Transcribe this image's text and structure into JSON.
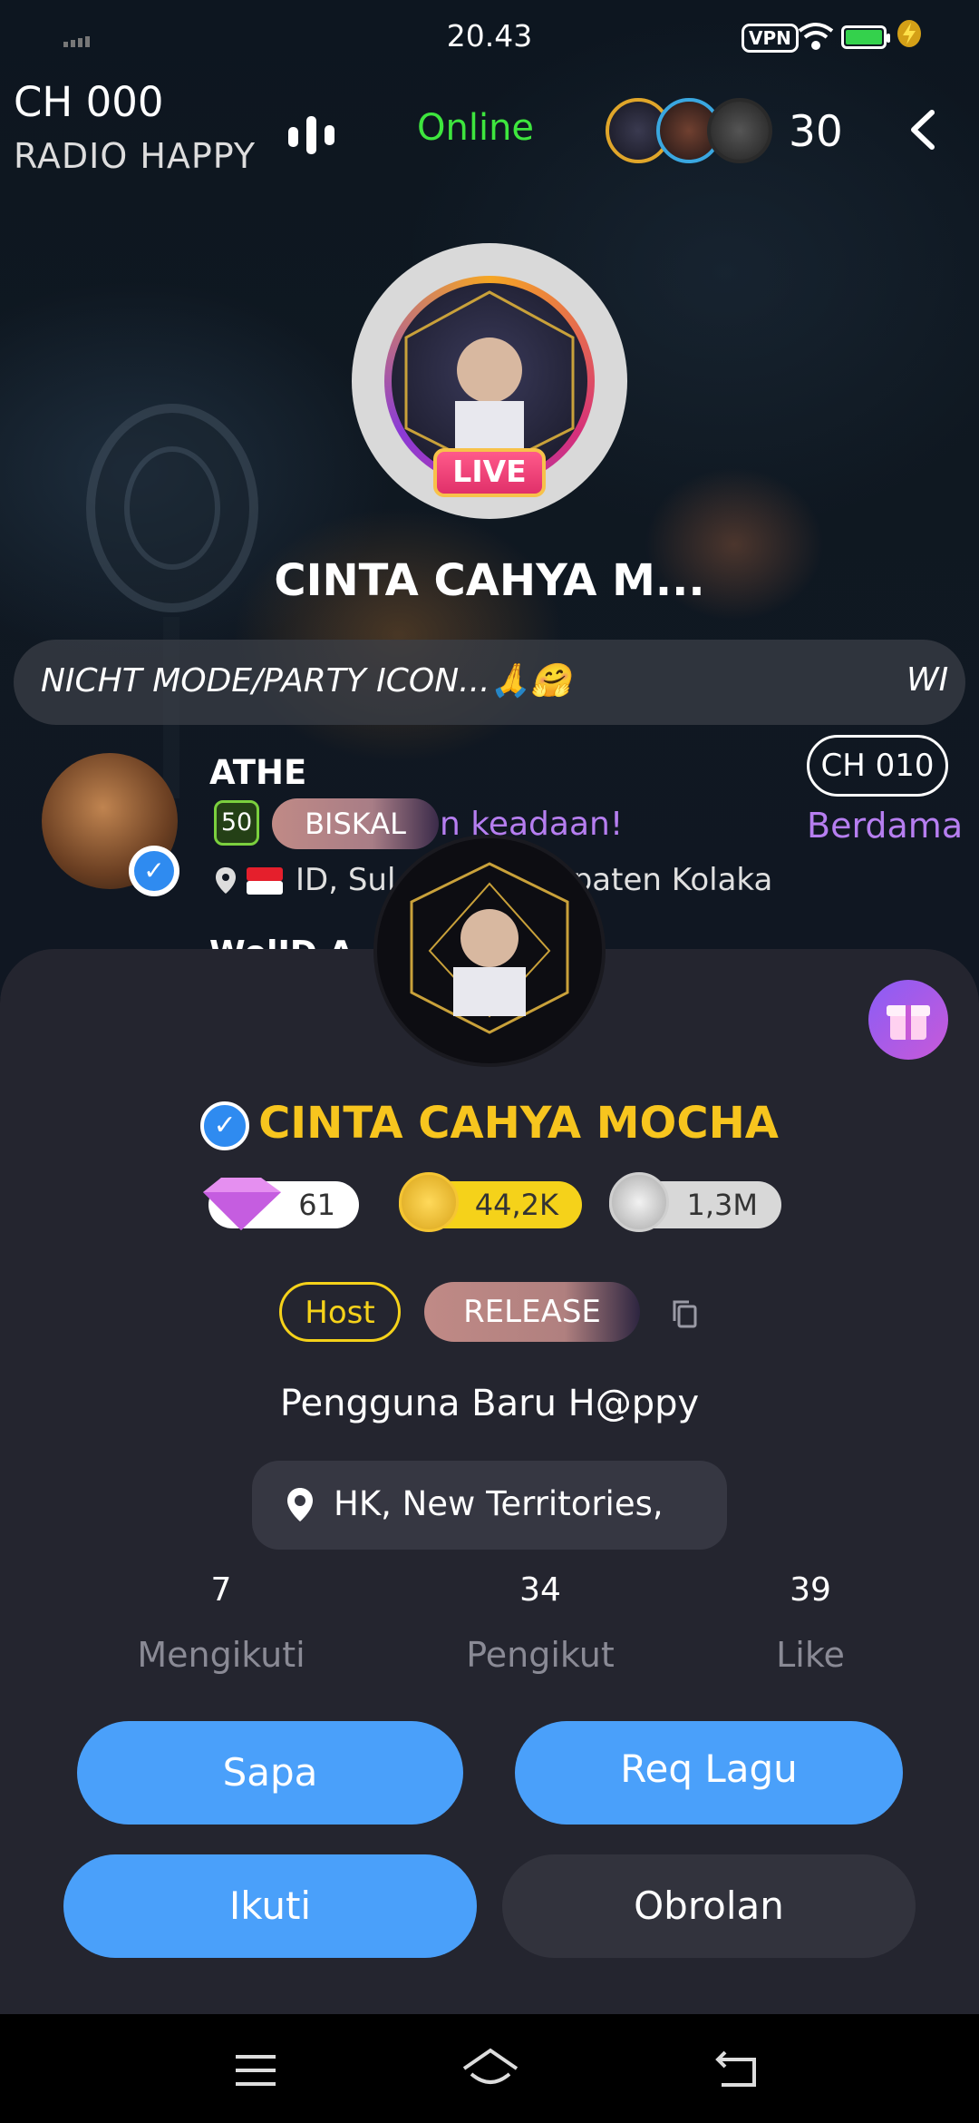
{
  "status_bar": {
    "time": "20.43",
    "vpn": "VPN"
  },
  "header": {
    "channel": "CH 000",
    "radio_name": "RADIO HAPPY",
    "status": "Online",
    "listener_count": "30"
  },
  "host": {
    "name": "CINTA CAHYA M...",
    "live_badge": "LIVE"
  },
  "marquee": {
    "text": "NICHT MODE/PARTY ICON...🙏🤗",
    "text_repeat": "WI"
  },
  "listener": {
    "name": "ATHE",
    "level": "50",
    "badge": "BISKAL",
    "channel_badge": "CH 010",
    "message": "n keadaan!",
    "message2": "Berdama",
    "location": "ID, Sul      gara, Kabupaten Kolaka",
    "next_name": "WolID A"
  },
  "profile": {
    "name": "CINTA CAHYA MOCHA",
    "diamonds": "61",
    "coins": "44,2K",
    "silver": "1,3M",
    "role_tag": "Host",
    "release_tag": "RELEASE",
    "bio": "Pengguna Baru H@ppy",
    "location": "HK, New Territories,",
    "stats": [
      {
        "value": "7",
        "label": "Mengikuti"
      },
      {
        "value": "34",
        "label": "Pengikut"
      },
      {
        "value": "39",
        "label": "Like"
      }
    ],
    "buttons": {
      "sapa": "Sapa",
      "req_lagu": "Req Lagu",
      "ikuti": "Ikuti",
      "obrolan": "Obrolan"
    }
  },
  "colors": {
    "accent_blue": "#4aa0fa",
    "gold": "#f7c51e",
    "online_green": "#3ee63e",
    "sheet_bg": "#24252f"
  }
}
